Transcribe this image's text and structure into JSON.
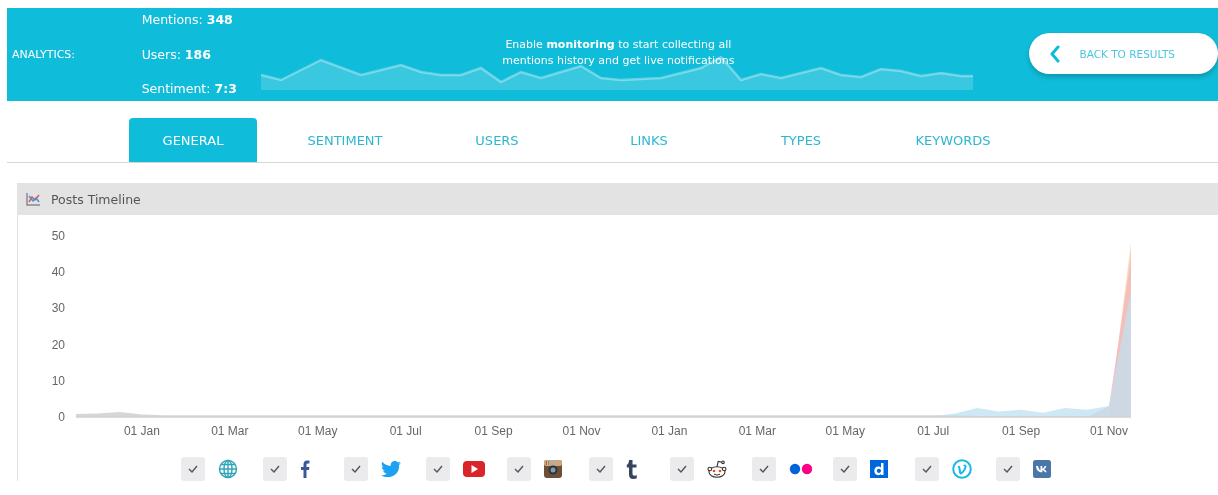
{
  "analytics": {
    "label": "ANALYTICS:",
    "stats": [
      {
        "label": "Mentions:",
        "value": "348"
      },
      {
        "label": "Users:",
        "value": "186"
      },
      {
        "label": "Sentiment:",
        "value": "7:3"
      }
    ],
    "notice": "Enable **monitoring** to start collecting all mentions history and get live notifications",
    "back_button": "BACK TO RESULTS"
  },
  "tabs": [
    {
      "label": "GENERAL",
      "selected": true
    },
    {
      "label": "SENTIMENT",
      "selected": false
    },
    {
      "label": "USERS",
      "selected": false
    },
    {
      "label": "LINKS",
      "selected": false
    },
    {
      "label": "TYPES",
      "selected": false
    },
    {
      "label": "KEYWORDS",
      "selected": false
    }
  ],
  "panel": {
    "title": "Posts Timeline",
    "chart_data": {
      "type": "area",
      "stacked": false,
      "categories": [
        null,
        null,
        null,
        "01 Jan",
        null,
        null,
        null,
        "01 Mar",
        null,
        null,
        null,
        "01 May",
        null,
        null,
        null,
        "01 Jul",
        null,
        null,
        null,
        "01 Sep",
        null,
        null,
        null,
        "01 Nov",
        null,
        null,
        null,
        "01 Jan",
        null,
        null,
        null,
        "01 Mar",
        null,
        null,
        null,
        "01 May",
        null,
        null,
        null,
        "01 Jul",
        null,
        null,
        null,
        "01 Sep",
        null,
        null,
        null,
        "01 Nov",
        null
      ],
      "series": [
        {
          "color": "#c8c8cc",
          "values": [
            0.8,
            1.0,
            1.4,
            0.7,
            0.5,
            0.5,
            0.5,
            0.5,
            0.5,
            0.5,
            0.5,
            0.5,
            0.5,
            0.5,
            0.5,
            0.5,
            0.5,
            0.5,
            0.5,
            0.5,
            0.5,
            0.5,
            0.5,
            0.5,
            0.5,
            0.5,
            0.5,
            0.5,
            0.5,
            0.5,
            0.5,
            0.5,
            0.5,
            0.5,
            0.5,
            0.5,
            0.5,
            0.5,
            0.5,
            0.5,
            0.5,
            0.3,
            0.3,
            0.3,
            0.3,
            0.3,
            0.3,
            0.3,
            0.3
          ]
        },
        {
          "color": "#f6c9a8",
          "values": [
            0,
            0,
            0,
            0,
            0,
            0,
            0,
            0,
            0,
            0,
            0,
            0,
            0,
            0,
            0,
            0,
            0,
            0,
            0,
            0,
            0,
            0,
            0,
            0,
            0,
            0,
            0,
            0,
            0,
            0,
            0,
            0,
            0,
            0,
            0,
            0,
            0,
            0,
            0,
            0,
            0,
            0,
            0,
            0,
            0,
            0,
            0,
            0,
            48
          ]
        },
        {
          "color": "#f4b6b6",
          "values": [
            0,
            0,
            0,
            0,
            0,
            0,
            0,
            0,
            0,
            0,
            0,
            0,
            0,
            0,
            0,
            0,
            0,
            0,
            0,
            0,
            0,
            0,
            0,
            0,
            0,
            0,
            0,
            0,
            0,
            0,
            0,
            0,
            0,
            0,
            0,
            0,
            0,
            0,
            0,
            0,
            0,
            0,
            0,
            0,
            0,
            0,
            0,
            3,
            44
          ]
        },
        {
          "color": "#bfe0f2",
          "values": [
            0,
            0,
            0,
            0,
            0,
            0,
            0,
            0,
            0.3,
            0.3,
            0.3,
            0.3,
            0.3,
            0.3,
            0.3,
            0.3,
            0.3,
            0.3,
            0.3,
            0.3,
            0.3,
            0.3,
            0.3,
            0.3,
            0.3,
            0.3,
            0.3,
            0.3,
            0.3,
            0.3,
            0.3,
            0.3,
            0.3,
            0.3,
            0.3,
            0.3,
            0.3,
            0.3,
            0.3,
            0.3,
            1,
            2.5,
            1.5,
            2,
            1.2,
            2.5,
            2,
            3,
            35
          ]
        }
      ],
      "ylim": [
        0,
        50
      ],
      "yticks": [
        0,
        10,
        20,
        30,
        40,
        50
      ]
    },
    "legend": [
      {
        "kind": "web",
        "checked": true
      },
      {
        "kind": "facebook",
        "checked": true
      },
      {
        "kind": "twitter",
        "checked": true
      },
      {
        "kind": "youtube",
        "checked": true
      },
      {
        "kind": "instagram",
        "checked": true
      },
      {
        "kind": "tumblr",
        "checked": true
      },
      {
        "kind": "reddit",
        "checked": true
      },
      {
        "kind": "flickr",
        "checked": true
      },
      {
        "kind": "dailymotion",
        "checked": true
      },
      {
        "kind": "vimeo",
        "checked": true
      },
      {
        "kind": "vk",
        "checked": true
      }
    ]
  }
}
